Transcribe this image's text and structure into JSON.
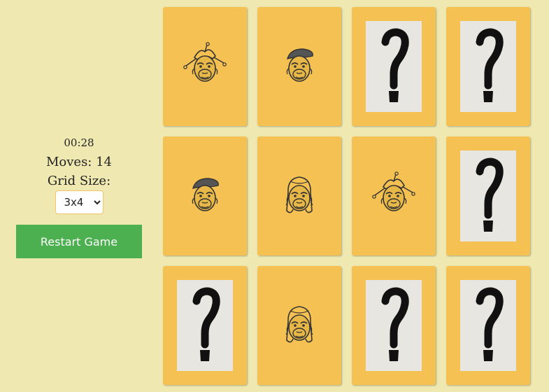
{
  "game": {
    "timer": "00:28",
    "moves_label": "Moves: 14",
    "grid_size_label": "Grid Size:",
    "grid_size_value": "3x4",
    "grid_size_options": [
      "3x4"
    ],
    "restart_label": "Restart Game"
  },
  "colors": {
    "background": "#efe9b1",
    "card": "#f5c152",
    "card_back": "#e8e6e1",
    "button": "#4caf50"
  },
  "cards": [
    {
      "state": "revealed",
      "icon": "gorilla-jester-icon"
    },
    {
      "state": "revealed",
      "icon": "gorilla-beret-icon"
    },
    {
      "state": "hidden",
      "icon": "question-mark-icon"
    },
    {
      "state": "hidden",
      "icon": "question-mark-icon"
    },
    {
      "state": "revealed",
      "icon": "gorilla-beret-icon"
    },
    {
      "state": "revealed",
      "icon": "gorilla-judge-wig-icon"
    },
    {
      "state": "revealed",
      "icon": "gorilla-jester-icon"
    },
    {
      "state": "hidden",
      "icon": "question-mark-icon"
    },
    {
      "state": "hidden",
      "icon": "question-mark-icon"
    },
    {
      "state": "revealed",
      "icon": "gorilla-judge-wig-icon"
    },
    {
      "state": "hidden",
      "icon": "question-mark-icon"
    },
    {
      "state": "hidden",
      "icon": "question-mark-icon"
    }
  ]
}
